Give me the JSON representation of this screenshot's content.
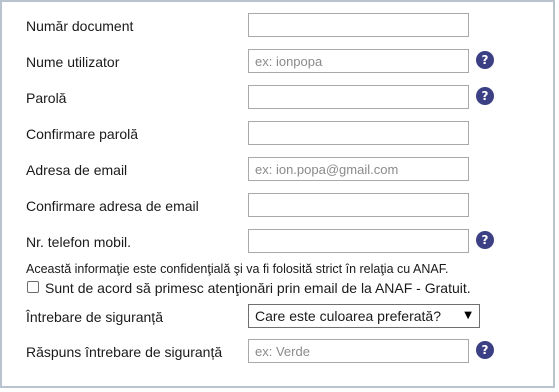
{
  "form": {
    "fields": [
      {
        "label": "Număr document",
        "value": "",
        "placeholder": "",
        "help": false
      },
      {
        "label": "Nume utilizator",
        "value": "",
        "placeholder": "ex: ionpopa",
        "help": true
      },
      {
        "label": "Parolă",
        "value": "",
        "placeholder": "",
        "help": true
      },
      {
        "label": "Confirmare parolă",
        "value": "",
        "placeholder": "",
        "help": false
      },
      {
        "label": "Adresa de email",
        "value": "",
        "placeholder": "ex: ion.popa@gmail.com",
        "help": false
      },
      {
        "label": "Confirmare adresa de email",
        "value": "",
        "placeholder": "",
        "help": false
      },
      {
        "label": "Nr. telefon mobil.",
        "value": "",
        "placeholder": "",
        "help": true
      }
    ],
    "help_symbol": "?",
    "notice": "Această informaţie este confidenţială şi va fi folosită strict în relaţia cu ANAF.",
    "consent": {
      "label": "Sunt de acord să primesc atenţionări prin email de la ANAF - Gratuit.",
      "checked": false
    },
    "security_question": {
      "label": "Întrebare de siguranță",
      "selected": "Care este culoarea preferată?"
    },
    "security_answer": {
      "label": "Răspuns întrebare de siguranță",
      "value": "",
      "placeholder": "ex: Verde",
      "help": true
    }
  },
  "colors": {
    "help_icon": "#3b3f84",
    "frame_border": "#b9c3ce"
  }
}
